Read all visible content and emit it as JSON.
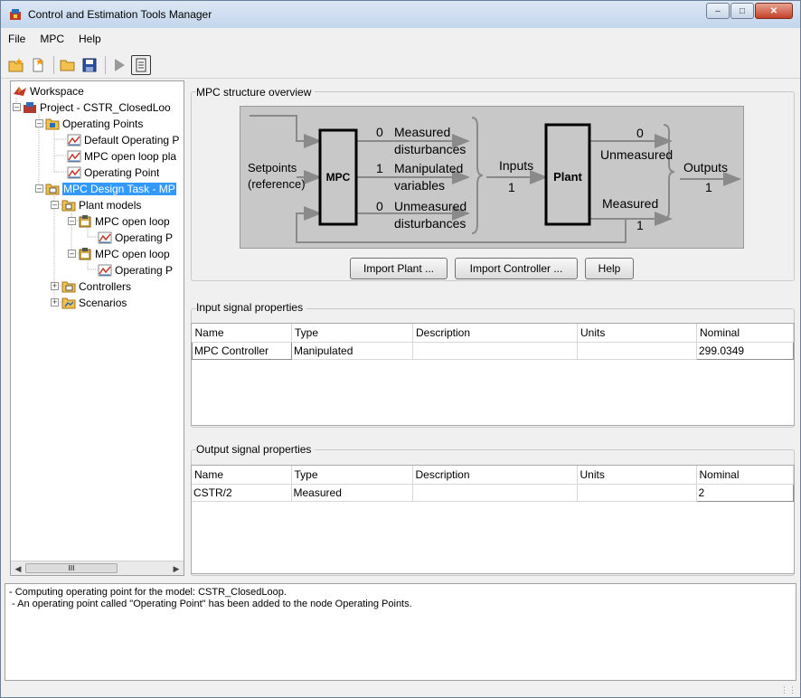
{
  "window": {
    "title": "Control and Estimation Tools Manager"
  },
  "menu": [
    "File",
    "MPC",
    "Help"
  ],
  "tree": [
    {
      "label": "Workspace",
      "icon": "matlab-workspace-icon"
    },
    {
      "label": "Project - CSTR_ClosedLoo",
      "icon": "simulink-project-icon"
    },
    {
      "label": "Operating Points",
      "icon": "folder-icon"
    },
    {
      "label": "Default Operating P",
      "icon": "operating-point-icon"
    },
    {
      "label": "MPC open loop pla",
      "icon": "operating-point-icon"
    },
    {
      "label": "Operating Point",
      "icon": "operating-point-icon"
    },
    {
      "label": "MPC Design Task - MP",
      "icon": "mpc-task-icon",
      "selected": true
    },
    {
      "label": "Plant models",
      "icon": "plant-models-icon"
    },
    {
      "label": "MPC open loop",
      "icon": "plant-model-icon"
    },
    {
      "label": "Operating P",
      "icon": "operating-point-icon"
    },
    {
      "label": "MPC open loop",
      "icon": "plant-model-icon"
    },
    {
      "label": "Operating P",
      "icon": "operating-point-icon"
    },
    {
      "label": "Controllers",
      "icon": "controllers-icon"
    },
    {
      "label": "Scenarios",
      "icon": "scenarios-icon"
    }
  ],
  "overview": {
    "title": "MPC structure overview",
    "setpoints": "Setpoints",
    "reference": "(reference)",
    "mpc": "MPC",
    "plant": "Plant",
    "measured_dist_count": "0",
    "measured_dist_l1": "Measured",
    "measured_dist_l2": "disturbances",
    "manip_count": "1",
    "manip_l1": "Manipulated",
    "manip_l2": "variables",
    "unmeas_dist_count": "0",
    "unmeas_dist_l1": "Unmeasured",
    "unmeas_dist_l2": "disturbances",
    "inputs_label": "Inputs",
    "inputs_count": "1",
    "unmeasured_out_count": "0",
    "unmeasured_out_label": "Unmeasured",
    "measured_out_label": "Measured",
    "measured_out_count": "1",
    "outputs_label": "Outputs",
    "outputs_count": "1"
  },
  "buttons": {
    "import_plant": "Import Plant ...",
    "import_controller": "Import Controller ...",
    "help": "Help"
  },
  "input_signals": {
    "title": "Input signal properties",
    "columns": [
      "Name",
      "Type",
      "Description",
      "Units",
      "Nominal"
    ],
    "rows": [
      [
        "MPC Controller",
        "Manipulated",
        "",
        "",
        "299.0349"
      ]
    ]
  },
  "output_signals": {
    "title": "Output signal properties",
    "columns": [
      "Name",
      "Type",
      "Description",
      "Units",
      "Nominal"
    ],
    "rows": [
      [
        "CSTR/2",
        "Measured",
        "",
        "",
        "2"
      ]
    ]
  },
  "log": [
    "- Computing operating point for the model: CSTR_ClosedLoop.",
    " - An operating point called \"Operating Point\" has been added to the node Operating Points."
  ],
  "scroll_thumb": "III"
}
